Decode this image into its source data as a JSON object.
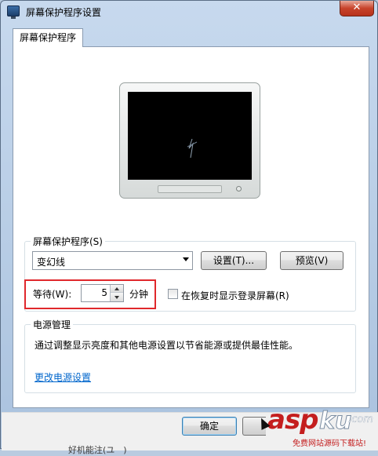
{
  "window": {
    "title": "屏幕保护程序设置",
    "close_glyph": "✕"
  },
  "tab": {
    "label": "屏幕保护程序"
  },
  "screensaver_group": {
    "label": "屏幕保护程序(S)",
    "selected": "变幻线",
    "settings_button": "设置(T)...",
    "preview_button": "预览(V)"
  },
  "wait": {
    "label": "等待(W):",
    "value": "5",
    "unit": "分钟",
    "highlight_color": "#e0282c"
  },
  "resume_checkbox": {
    "label": "在恢复时显示登录屏幕(R)",
    "checked": false
  },
  "power_group": {
    "label": "电源管理",
    "description": "通过调整显示亮度和其他电源设置以节省能源或提供最佳性能。",
    "link": "更改电源设置"
  },
  "footer": {
    "ok_button": "确定"
  },
  "watermark": {
    "part1": "asp",
    "part2": "ku",
    "part3": ".com",
    "tagline": "免费网站源码下载站!"
  },
  "background_text": {
    "left_fragment": "好机能注(ユ　)"
  },
  "icons": [
    "display-settings-icon",
    "close-icon",
    "dropdown-arrow-icon",
    "spin-up-icon",
    "spin-down-icon",
    "mouse-cursor-icon"
  ]
}
